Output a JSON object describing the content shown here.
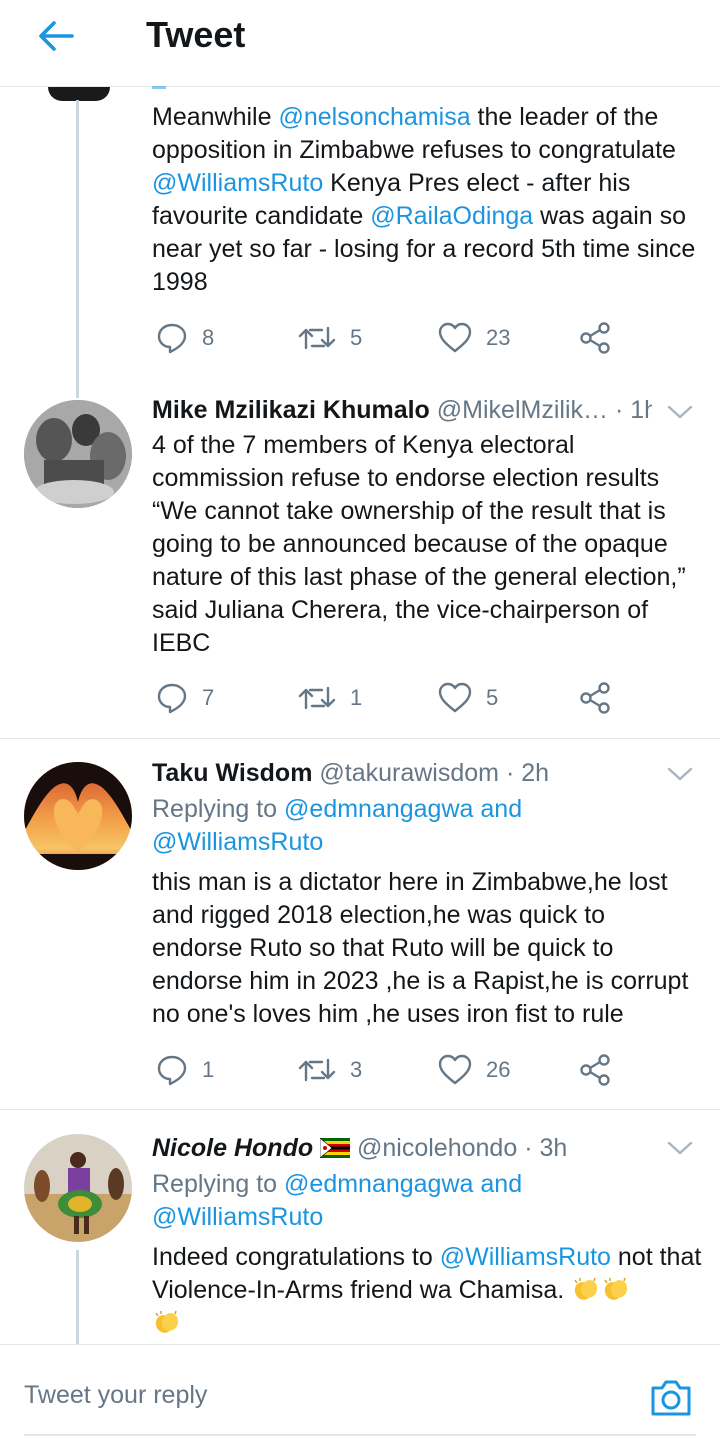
{
  "header": {
    "title": "Tweet"
  },
  "tweets": [
    {
      "text_parts": [
        "Meanwhile ",
        "@nelsonchamisa",
        " the leader of the opposition in Zimbabwe refuses to congratulate ",
        "@WilliamsRuto",
        " Kenya Pres elect - after his favourite candidate ",
        "@RailaOdinga",
        " was again so near yet so far - losing for a record 5th time since 1998"
      ],
      "replies": "8",
      "retweets": "5",
      "likes": "23"
    },
    {
      "name": "Mike Mzilikazi Khumalo",
      "handle": "@MikelMzilik…",
      "time": "· 1h",
      "text": "4 of the 7 members of Kenya electoral commission refuse to endorse election results “We cannot take ownership of the result that is going to be announced because of the opaque nature of this last phase of the general election,” said Juliana Cherera, the vice-chairperson of IEBC",
      "replies": "7",
      "retweets": "1",
      "likes": "5"
    },
    {
      "name": "Taku Wisdom",
      "handle": "@takurawisdom",
      "time": "· 2h",
      "replying_prefix": "Replying to ",
      "replying_user1": "@edmnangagwa",
      "replying_and": " and",
      "replying_user2": "@WilliamsRuto",
      "text": "this man is a dictator here in Zimbabwe,he lost and rigged 2018 election,he was quick to endorse Ruto so that Ruto will be quick to endorse him in 2023 ,he is a Rapist,he is corrupt no one's loves him ,he uses iron fist to rule",
      "replies": "1",
      "retweets": "3",
      "likes": "26"
    },
    {
      "name": "Nicole Hondo",
      "handle": "@nicolehondo",
      "time": "· 3h",
      "replying_prefix": "Replying to ",
      "replying_user1": "@edmnangagwa",
      "replying_and": " and",
      "replying_user2": "@WilliamsRuto",
      "text_parts": [
        "Indeed congratulations to ",
        "@WilliamsRuto",
        " not that Violence-In-Arms friend wa Chamisa. "
      ]
    }
  ],
  "reply_bar": {
    "placeholder": "Tweet your reply"
  },
  "icons": {
    "back": "arrow-left-icon",
    "reply": "reply-bubble-icon",
    "retweet": "retweet-icon",
    "like": "heart-icon",
    "share": "share-icon",
    "caret": "chevron-down-icon",
    "camera": "camera-icon",
    "flag": "zimbabwe-flag-emoji",
    "clap": "clapping-hands-emoji"
  },
  "colors": {
    "accent": "#1b95e0",
    "text": "#14171a",
    "secondary": "#657786",
    "divider": "#e1e8ed"
  }
}
